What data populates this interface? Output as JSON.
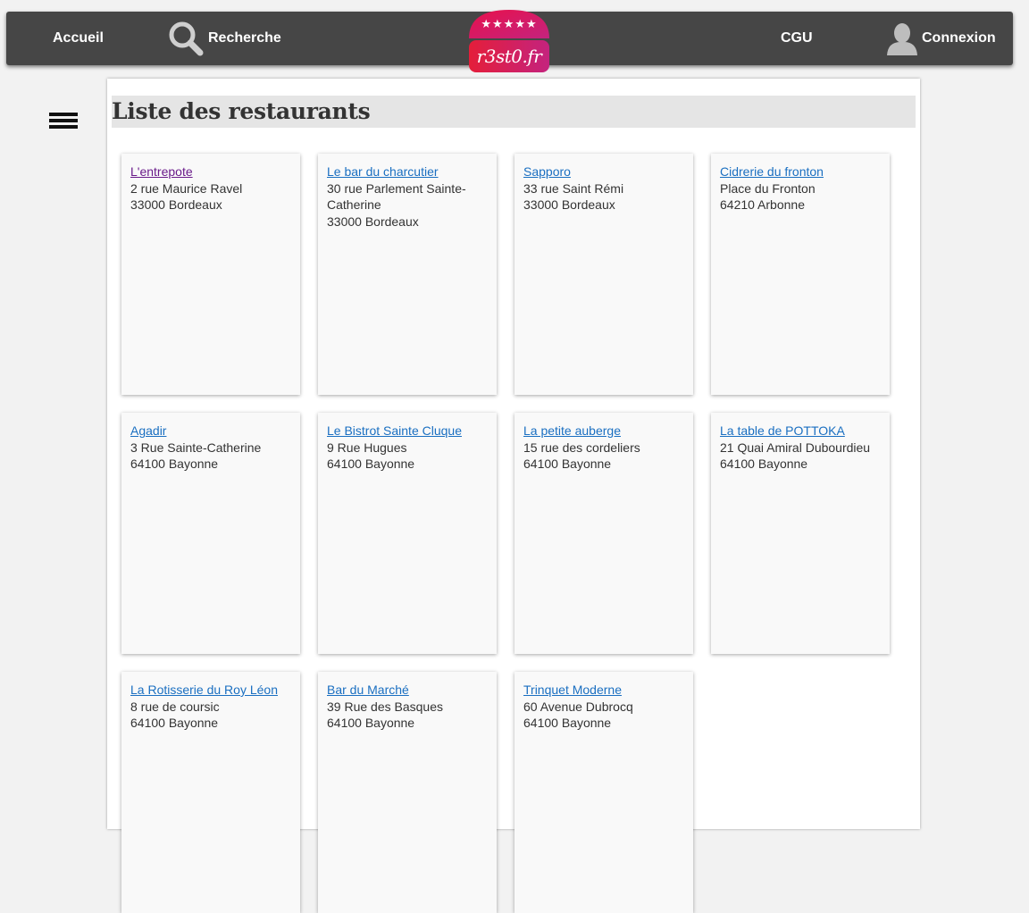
{
  "nav": {
    "home_label": "Accueil",
    "search_label": "Recherche",
    "terms_label": "CGU",
    "login_label": "Connexion",
    "logo_text": "r3st0.fr",
    "logo_stars": "★★★★★"
  },
  "page": {
    "title": "Liste des restaurants"
  },
  "restaurants": [
    {
      "name": "L'entrepote",
      "street": "2 rue Maurice Ravel",
      "city": "33000 Bordeaux"
    },
    {
      "name": "Le bar du charcutier",
      "street": "30 rue Parlement Sainte-Catherine",
      "city": "33000 Bordeaux"
    },
    {
      "name": "Sapporo",
      "street": "33 rue Saint Rémi",
      "city": "33000 Bordeaux"
    },
    {
      "name": "Cidrerie du fronton",
      "street": "Place du Fronton",
      "city": "64210 Arbonne"
    },
    {
      "name": "Agadir",
      "street": "3 Rue Sainte-Catherine",
      "city": "64100 Bayonne"
    },
    {
      "name": "Le Bistrot Sainte Cluque",
      "street": "9 Rue Hugues",
      "city": "64100 Bayonne"
    },
    {
      "name": "La petite auberge",
      "street": "15 rue des cordeliers",
      "city": "64100 Bayonne"
    },
    {
      "name": "La table de POTTOKA",
      "street": "21 Quai Amiral Dubourdieu",
      "city": "64100 Bayonne"
    },
    {
      "name": "La Rotisserie du Roy Léon",
      "street": "8 rue de coursic",
      "city": "64100 Bayonne"
    },
    {
      "name": "Bar du Marché",
      "street": "39 Rue des Basques",
      "city": "64100 Bayonne"
    },
    {
      "name": "Trinquet Moderne",
      "street": "60 Avenue Dubrocq",
      "city": "64100 Bayonne"
    }
  ],
  "colors": {
    "navbar": "#464646",
    "link": "#1a6fc1",
    "visited_link": "#6a1b8a",
    "logo_top": "#e8114b",
    "logo_bottom": "#c4237e"
  }
}
